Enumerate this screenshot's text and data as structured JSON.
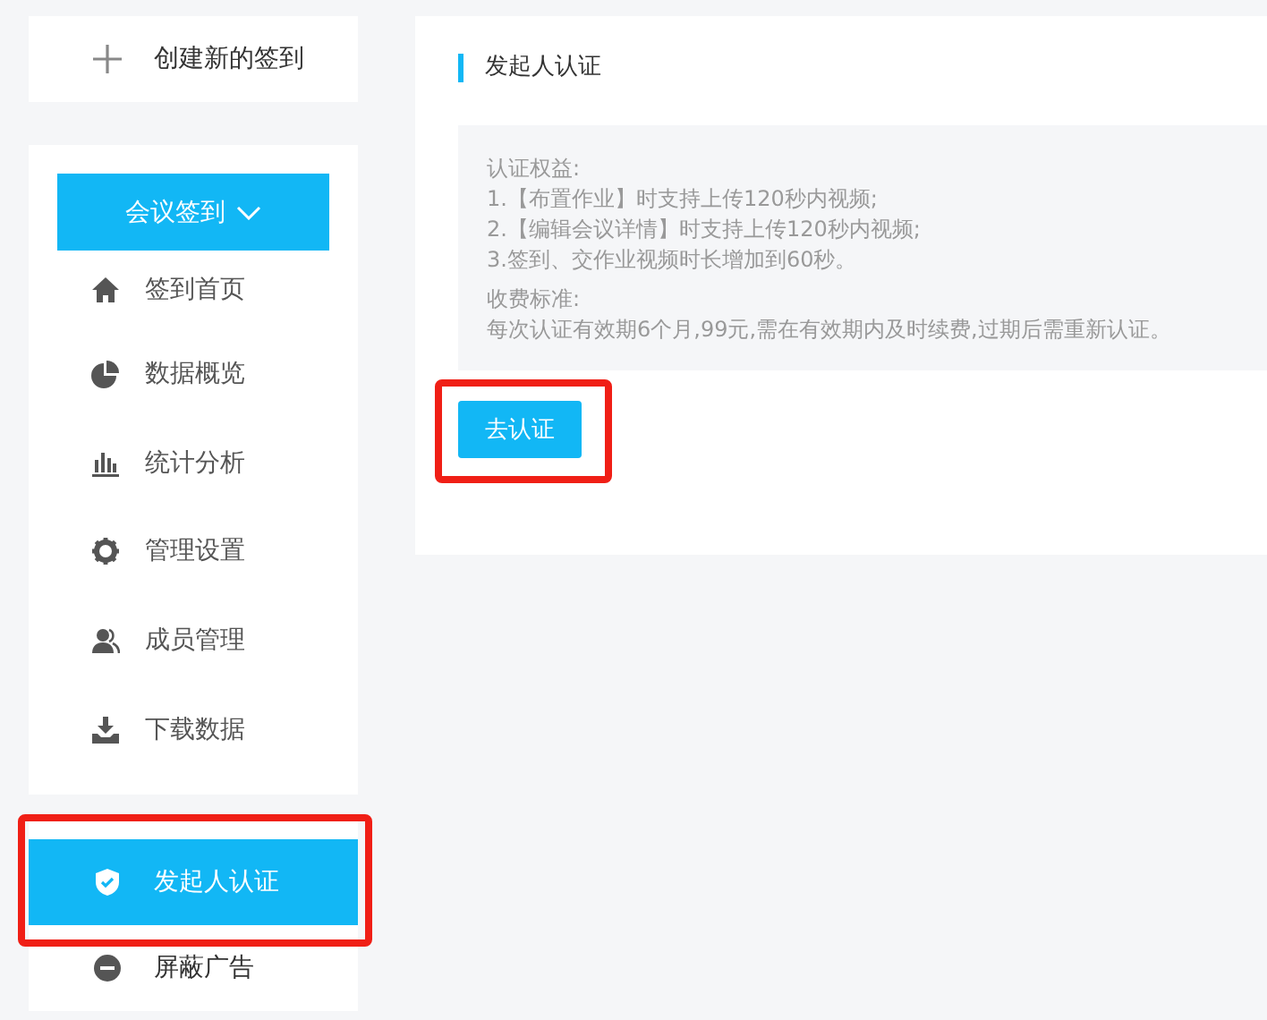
{
  "sidebar": {
    "create_button": "创建新的签到",
    "menu_header": "会议签到",
    "items": [
      {
        "label": "签到首页",
        "selected": false
      },
      {
        "label": "数据概览",
        "selected": false
      },
      {
        "label": "统计分析",
        "selected": false
      },
      {
        "label": "管理设置",
        "selected": false
      },
      {
        "label": "成员管理",
        "selected": false
      },
      {
        "label": "下载数据",
        "selected": false
      }
    ],
    "extra_items": [
      {
        "label": "发起人认证",
        "selected": true,
        "highlighted": true
      },
      {
        "label": "屏蔽广告",
        "selected": false,
        "highlighted": false
      }
    ]
  },
  "main": {
    "title": "发起人认证",
    "benefits_heading": "认证权益:",
    "benefits": [
      "1.【布置作业】时支持上传120秒内视频;",
      "2.【编辑会议详情】时支持上传120秒内视频;",
      "3.签到、交作业视频时长增加到60秒。"
    ],
    "pricing_heading": "收费标准:",
    "pricing_text": "每次认证有效期6个月,99元,需在有效期内及时续费,过期后需重新认证。",
    "action_button": {
      "label": "去认证",
      "highlighted": true
    }
  }
}
